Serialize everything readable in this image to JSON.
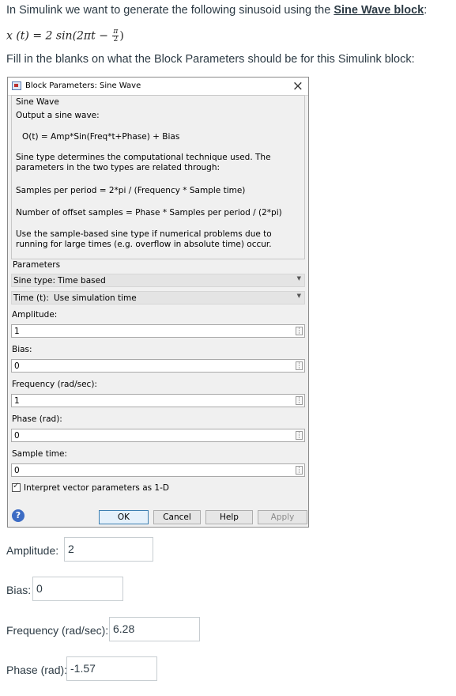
{
  "question": {
    "intro_prefix": "In Simulink we want to generate the following sinusoid using the ",
    "intro_link": "Sine Wave block",
    "intro_suffix": ":",
    "formula_lhs": "x (t) = 2 sin(2πt −",
    "formula_frac_num": "π",
    "formula_frac_den": "2",
    "formula_close": ")",
    "instruction": "Fill in the blanks on what the Block Parameters should be for this Simulink block:"
  },
  "dialog": {
    "title": "Block Parameters: Sine Wave",
    "close_glyph": "×",
    "block_name": "Sine Wave",
    "output_desc": "Output a sine wave:",
    "equation": "O(t) = Amp*Sin(Freq*t+Phase) + Bias",
    "sine_type_desc": "Sine type determines the computational technique used. The parameters in the two types are related through:",
    "samples_per_period": "Samples per period = 2*pi / (Frequency * Sample time)",
    "offset_samples": "Number of offset samples = Phase * Samples per period / (2*pi)",
    "sample_based_note": "Use the sample-based sine type if numerical problems due to running for large times (e.g. overflow in absolute time) occur.",
    "parameters_label": "Parameters",
    "sine_type": {
      "label": "Sine type:",
      "value": "Time based"
    },
    "time": {
      "label": "Time (t):",
      "value": "Use simulation time"
    },
    "fields": [
      {
        "label": "Amplitude:",
        "value": "1"
      },
      {
        "label": "Bias:",
        "value": "0"
      },
      {
        "label": "Frequency (rad/sec):",
        "value": "1"
      },
      {
        "label": "Phase (rad):",
        "value": "0"
      },
      {
        "label": "Sample time:",
        "value": "0"
      }
    ],
    "checkbox_label": "Interpret vector parameters as 1-D",
    "buttons": {
      "ok": "OK",
      "cancel": "Cancel",
      "help": "Help",
      "apply": "Apply"
    },
    "help_glyph": "?"
  },
  "answers": [
    {
      "label": "Amplitude:",
      "value": "2"
    },
    {
      "label": "Bias:",
      "value": "0"
    },
    {
      "label": "Frequency (rad/sec):",
      "value": "6.28"
    },
    {
      "label": "Phase (rad):",
      "value": "-1.57"
    }
  ]
}
